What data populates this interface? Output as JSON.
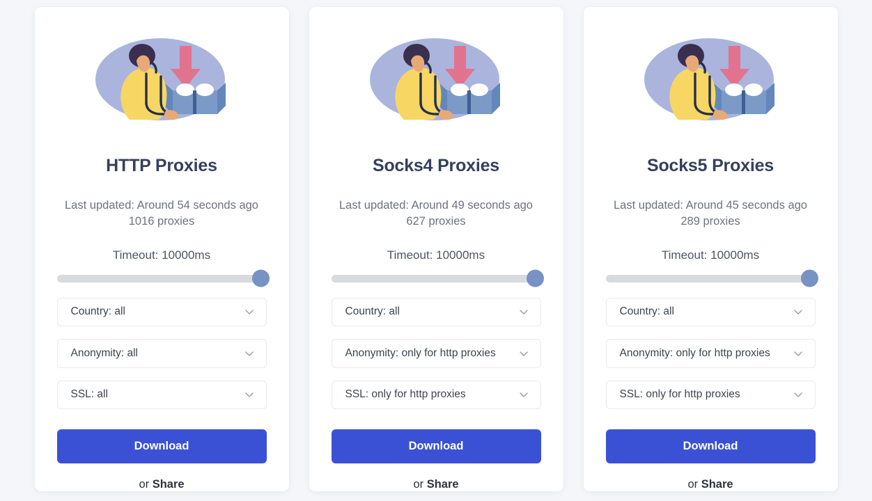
{
  "page": {
    "background_color": "#f4f6f9",
    "accent_color": "#3a51d6",
    "title_color": "#36405c"
  },
  "icons": {
    "chevron_down": "chevron-down-icon",
    "illustration": "person-receiving-package-illustration"
  },
  "illustration_colors": {
    "blob": "#aab4dd",
    "coat": "#f7d664",
    "hair": "#3a2f4f",
    "skin": "#e8a977",
    "box": "#7b9ac8",
    "box_dark": "#5f7eb0",
    "paper": "#ffffff",
    "arrow": "#e2738f",
    "outline": "#26314a"
  },
  "cards": [
    {
      "title": "HTTP Proxies",
      "last_updated": "Last updated: Around 54 seconds ago",
      "proxy_count": "1016 proxies",
      "timeout_label": "Timeout: 10000ms",
      "timeout_value": 10000,
      "timeout_max": 10000,
      "selects": [
        {
          "name": "country",
          "label": "Country: all"
        },
        {
          "name": "anonymity",
          "label": "Anonymity: all"
        },
        {
          "name": "ssl",
          "label": "SSL: all"
        }
      ],
      "download_label": "Download",
      "share_prefix": "or ",
      "share_label": "Share"
    },
    {
      "title": "Socks4 Proxies",
      "last_updated": "Last updated: Around 49 seconds ago",
      "proxy_count": "627 proxies",
      "timeout_label": "Timeout: 10000ms",
      "timeout_value": 10000,
      "timeout_max": 10000,
      "selects": [
        {
          "name": "country",
          "label": "Country: all"
        },
        {
          "name": "anonymity",
          "label": "Anonymity: only for http proxies"
        },
        {
          "name": "ssl",
          "label": "SSL: only for http proxies"
        }
      ],
      "download_label": "Download",
      "share_prefix": "or ",
      "share_label": "Share"
    },
    {
      "title": "Socks5 Proxies",
      "last_updated": "Last updated: Around 45 seconds ago",
      "proxy_count": "289 proxies",
      "timeout_label": "Timeout: 10000ms",
      "timeout_value": 10000,
      "timeout_max": 10000,
      "selects": [
        {
          "name": "country",
          "label": "Country: all"
        },
        {
          "name": "anonymity",
          "label": "Anonymity: only for http proxies"
        },
        {
          "name": "ssl",
          "label": "SSL: only for http proxies"
        }
      ],
      "download_label": "Download",
      "share_prefix": "or ",
      "share_label": "Share"
    }
  ]
}
